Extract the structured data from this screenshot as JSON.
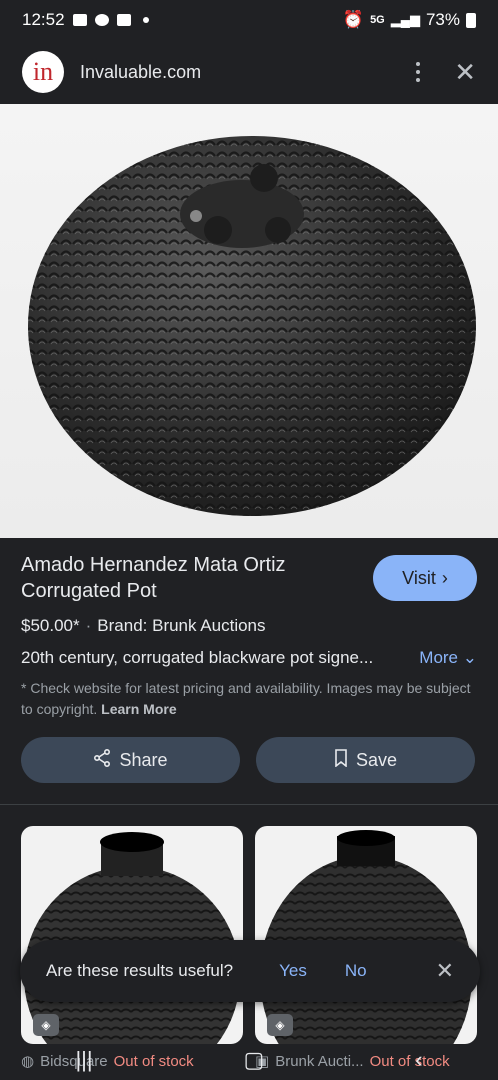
{
  "status": {
    "time": "12:52",
    "network": "5G",
    "battery": "73%"
  },
  "url_bar": {
    "logo_text": "in",
    "site": "Invaluable.com"
  },
  "product": {
    "title": "Amado Hernandez Mata Ortiz Corrugated Pot",
    "visit_label": "Visit",
    "price": "$50.00*",
    "brand": "Brand: Brunk Auctions",
    "description": "20th century, corrugated blackware pot signe...",
    "more_label": "More",
    "note": "* Check website for latest pricing and availability. Images may be subject to copyright.",
    "learn_more": "Learn More"
  },
  "actions": {
    "share_label": "Share",
    "save_label": "Save"
  },
  "toast": {
    "question": "Are these results useful?",
    "yes": "Yes",
    "no": "No"
  },
  "related": [
    {
      "source": "Bidsquare",
      "stock": "Out of stock"
    },
    {
      "source": "Brunk Aucti...",
      "stock": "Out of stock"
    }
  ],
  "colors": {
    "accent": "#8ab4f8",
    "background": "#202124",
    "button": "#3c4858",
    "out_of_stock": "#f28b82"
  }
}
